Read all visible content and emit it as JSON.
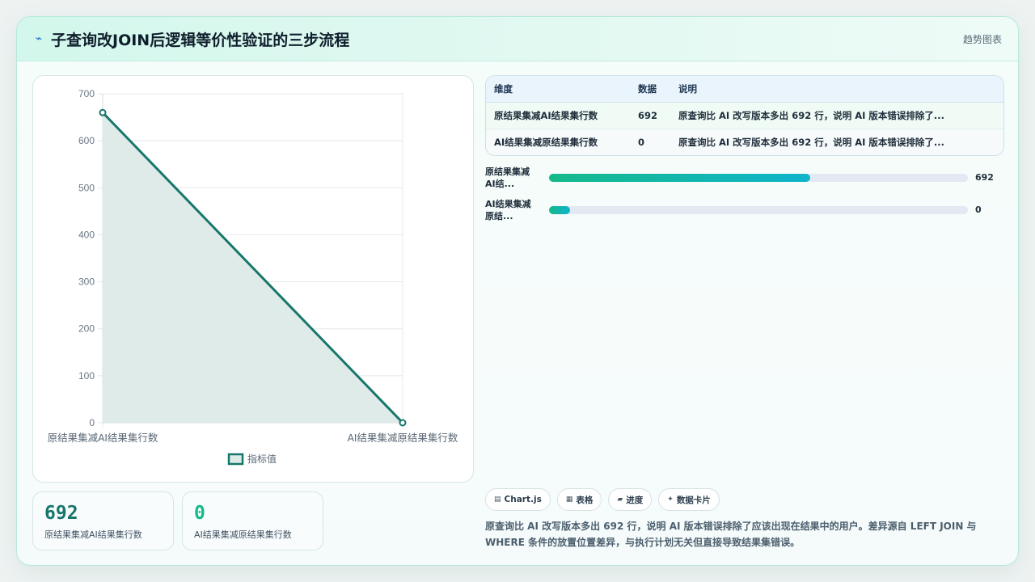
{
  "header": {
    "title": "子查询改JOIN后逻辑等价性验证的三步流程",
    "tag": "趋势图表",
    "icon": "sparkline-icon"
  },
  "chart_data": {
    "type": "area",
    "categories": [
      "原结果集减AI结果集行数",
      "AI结果集减原结果集行数"
    ],
    "series": [
      {
        "name": "指标值",
        "values": [
          660,
          0
        ]
      }
    ],
    "ylim": [
      0,
      700
    ],
    "yticks": [
      0,
      100,
      200,
      300,
      400,
      500,
      600,
      700
    ],
    "grid": true,
    "legend": "bottom",
    "colors": {
      "line": "#17766a",
      "fill": "#dceae8",
      "grid": "#e4e8ed"
    }
  },
  "kpis": [
    {
      "value": "692",
      "label": "原结果集减AI结果集行数",
      "color": "#17766a"
    },
    {
      "value": "0",
      "label": "AI结果集减原结果集行数",
      "color": "#14b98a"
    }
  ],
  "table": {
    "headers": [
      "维度",
      "数据",
      "说明"
    ],
    "rows": [
      [
        "原结果集减AI结果集行数",
        "692",
        "原查询比 AI 改写版本多出 692 行，说明 AI 版本错误排除了..."
      ],
      [
        "AI结果集减原结果集行数",
        "0",
        "原查询比 AI 改写版本多出 692 行，说明 AI 版本错误排除了..."
      ]
    ]
  },
  "bars": [
    {
      "label_line1": "原结果集减",
      "label_line2": "AI结...",
      "value": "692",
      "fraction": 0.623
    },
    {
      "label_line1": "AI结果集减",
      "label_line2": "原结...",
      "value": "0",
      "fraction": 0.05
    }
  ],
  "chips": [
    {
      "icon": "▤",
      "label": "Chart.js"
    },
    {
      "icon": "▦",
      "label": "表格"
    },
    {
      "icon": "▰",
      "label": "进度"
    },
    {
      "icon": "✦",
      "label": "数据卡片"
    }
  ],
  "summary": "原查询比 AI 改写版本多出 692 行，说明 AI 版本错误排除了应该出现在结果中的用户。差异源自 LEFT JOIN 与 WHERE 条件的放置位置差异，与执行计划无关但直接导致结果集错误。"
}
